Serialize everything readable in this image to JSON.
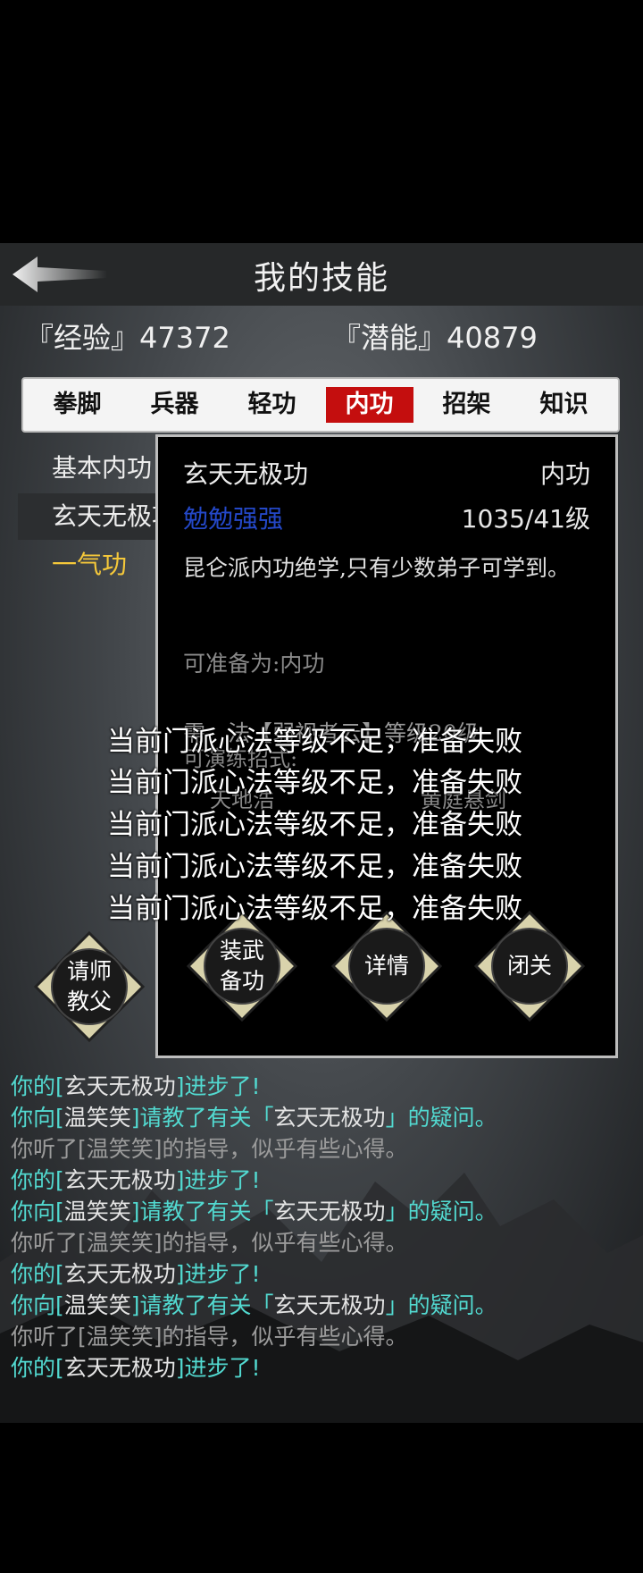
{
  "header": {
    "title": "我的技能"
  },
  "stats": {
    "exp_label": "『经验』47372",
    "pot_label": "『潜能』40879"
  },
  "tabs": [
    "拳脚",
    "兵器",
    "轻功",
    "内功",
    "招架",
    "知识"
  ],
  "active_tab": 3,
  "skills": [
    "基本内功",
    "玄天无极功",
    "一气功"
  ],
  "panel": {
    "name": "玄天无极功",
    "type": "内功",
    "rank": "勉勉强强",
    "level": "1035/41级",
    "desc": "昆仑派内功绝学,只有少数弟子可学到。",
    "prep": "可准备为:内功",
    "requirement": "需　法【弱视者云】等级20级",
    "sub_title": "可演练招式:",
    "sub_left": "天地浩",
    "sub_right": "黄庭悬剑"
  },
  "buttons": {
    "ask_master": "请师\n教父",
    "equip": "装武\n备功",
    "detail": "详情",
    "seclusion": "闭关"
  },
  "toasts": [
    "当前门派心法等级不足，准备失败",
    "当前门派心法等级不足，准备失败",
    "当前门派心法等级不足，准备失败",
    "当前门派心法等级不足，准备失败",
    "当前门派心法等级不足，准备失败"
  ],
  "log": [
    {
      "kind": "progress",
      "a": "你的[",
      "b": "玄天无极功",
      "c": "]进步了!"
    },
    {
      "kind": "ask",
      "a": "你向[",
      "b": "温笑笑",
      "c": "]请教了有关「",
      "d": "玄天无极功",
      "e": "」的疑问。"
    },
    {
      "kind": "gain",
      "text": "你听了[温笑笑]的指导，似乎有些心得。"
    },
    {
      "kind": "progress",
      "a": "你的[",
      "b": "玄天无极功",
      "c": "]进步了!"
    },
    {
      "kind": "ask",
      "a": "你向[",
      "b": "温笑笑",
      "c": "]请教了有关「",
      "d": "玄天无极功",
      "e": "」的疑问。"
    },
    {
      "kind": "gain",
      "text": "你听了[温笑笑]的指导，似乎有些心得。"
    },
    {
      "kind": "progress",
      "a": "你的[",
      "b": "玄天无极功",
      "c": "]进步了!"
    },
    {
      "kind": "ask",
      "a": "你向[",
      "b": "温笑笑",
      "c": "]请教了有关「",
      "d": "玄天无极功",
      "e": "」的疑问。"
    },
    {
      "kind": "gain",
      "text": "你听了[温笑笑]的指导，似乎有些心得。"
    },
    {
      "kind": "progress",
      "a": "你的[",
      "b": "玄天无极功",
      "c": "]进步了!"
    }
  ],
  "colors": {
    "accent_red": "#c40e0e",
    "gold": "#f5c83a",
    "cyan": "#52d9d0",
    "rank_blue": "#2448c8"
  }
}
